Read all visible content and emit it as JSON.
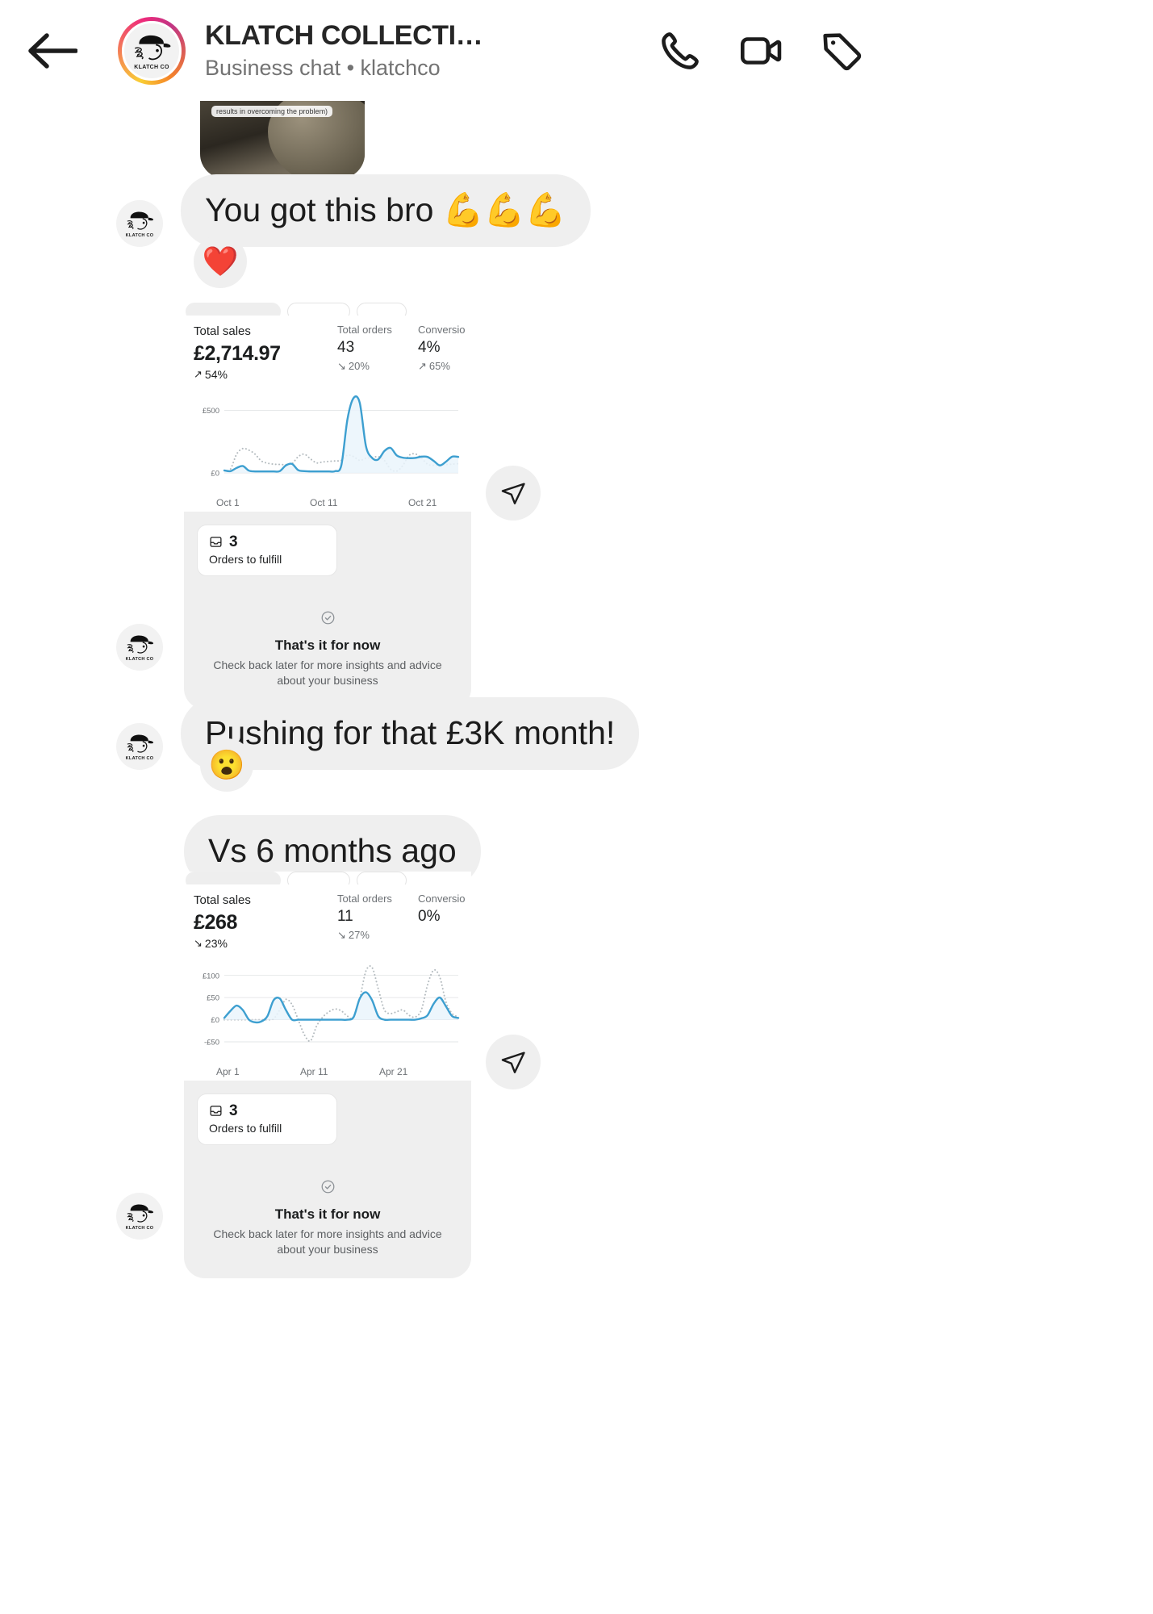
{
  "header": {
    "back_icon": "back-arrow-icon",
    "title": "KLATCH COLLECTI…",
    "subtitle": "Business chat • klatchco",
    "avatar_caption": "KLATCH CO",
    "actions": [
      {
        "icon": "phone-call-icon",
        "name": "voice-call-button"
      },
      {
        "icon": "video-camera-icon",
        "name": "video-call-button"
      },
      {
        "icon": "price-tag-icon",
        "name": "product-tag-button"
      }
    ]
  },
  "messages": {
    "clip_caption": "results in overcoming the problem)",
    "msg_you_got_this": "You got this bro 💪💪💪",
    "reaction_heart": "❤️",
    "msg_pushing": "Pushing for that £3K month!",
    "reaction_wow": "😮",
    "msg_vs": "Vs 6 months ago",
    "avatar_caption": "KLATCH CO"
  },
  "card_one": {
    "total_sales_label": "Total sales",
    "total_sales_value": "£2,714.97",
    "total_sales_delta": "54%",
    "total_sales_delta_dir": "up",
    "total_orders_label": "Total orders",
    "total_orders_value": "43",
    "total_orders_delta": "20%",
    "total_orders_delta_dir": "down",
    "conversion_label": "Conversio",
    "conversion_value": "4%",
    "conversion_delta": "65%",
    "conversion_delta_dir": "up",
    "fulfill_count": "3",
    "fulfill_label": "Orders to fulfill",
    "end_title": "That's it for now",
    "end_sub": "Check back later for more insights and advice about your business"
  },
  "card_two": {
    "total_sales_label": "Total sales",
    "total_sales_value": "£268",
    "total_sales_delta": "23%",
    "total_sales_delta_dir": "down",
    "total_orders_label": "Total orders",
    "total_orders_value": "11",
    "total_orders_delta": "27%",
    "total_orders_delta_dir": "down",
    "conversion_label": "Conversio",
    "conversion_value": "0%",
    "conversion_delta": "",
    "conversion_delta_dir": "",
    "fulfill_count": "3",
    "fulfill_label": "Orders to fulfill",
    "end_title": "That's it for now",
    "end_sub": "Check back later for more insights and advice about your business"
  },
  "colors": {
    "accent_line": "#3d9fd0",
    "bubble_bg": "#efefef",
    "text_primary": "#1c1c1c",
    "text_muted": "#6d7175"
  },
  "chart_data": [
    {
      "type": "line",
      "title": "Total sales",
      "xlabel": "",
      "ylabel": "",
      "ytick_labels": [
        "£0",
        "£500"
      ],
      "ylim": [
        0,
        620
      ],
      "xtick_labels": [
        "Oct 1",
        "Oct 11",
        "Oct 21"
      ],
      "grid": true,
      "legend": "none",
      "series": [
        {
          "name": "This period",
          "style": "solid",
          "color": "#3d9fd0",
          "values": [
            20,
            14,
            40,
            55,
            18,
            12,
            12,
            12,
            12,
            14,
            60,
            72,
            22,
            14,
            12,
            12,
            12,
            12,
            14,
            60,
            430,
            600,
            560,
            215,
            120,
            108,
            175,
            200,
            140,
            122,
            118,
            120,
            130,
            128,
            96,
            60,
            90,
            130,
            128
          ]
        },
        {
          "name": "Previous period",
          "style": "dotted",
          "color": "#b5bcc0",
          "values": [
            18,
            30,
            150,
            195,
            182,
            150,
            96,
            78,
            70,
            68,
            66,
            74,
            130,
            150,
            112,
            80,
            88,
            92,
            96,
            100,
            142,
            130,
            100,
            118,
            122,
            130,
            100,
            30,
            14,
            60,
            140,
            152,
            120,
            70,
            60,
            62,
            66,
            70,
            74
          ]
        }
      ]
    },
    {
      "type": "line",
      "title": "Total sales",
      "xlabel": "",
      "ylabel": "",
      "ytick_labels": [
        "-£50",
        "£0",
        "£50",
        "£100"
      ],
      "ylim": [
        -50,
        125
      ],
      "xtick_labels": [
        "Apr 1",
        "Apr 11",
        "Apr 21"
      ],
      "grid": true,
      "legend": "none",
      "series": [
        {
          "name": "This period",
          "style": "solid",
          "color": "#3d9fd0",
          "values": [
            4,
            20,
            32,
            22,
            0,
            -6,
            -4,
            8,
            44,
            48,
            22,
            0,
            0,
            0,
            0,
            0,
            0,
            0,
            0,
            0,
            0,
            6,
            48,
            62,
            44,
            8,
            0,
            0,
            0,
            0,
            0,
            0,
            3,
            10,
            36,
            50,
            30,
            8,
            4
          ]
        },
        {
          "name": "Previous period",
          "style": "dotted",
          "color": "#b5bcc0",
          "values": [
            0,
            0,
            0,
            0,
            0,
            0,
            0,
            0,
            2,
            22,
            46,
            34,
            0,
            -34,
            -48,
            -14,
            6,
            18,
            24,
            20,
            8,
            4,
            48,
            110,
            118,
            70,
            22,
            14,
            18,
            22,
            10,
            6,
            22,
            78,
            112,
            96,
            40,
            14,
            6
          ]
        }
      ]
    }
  ]
}
